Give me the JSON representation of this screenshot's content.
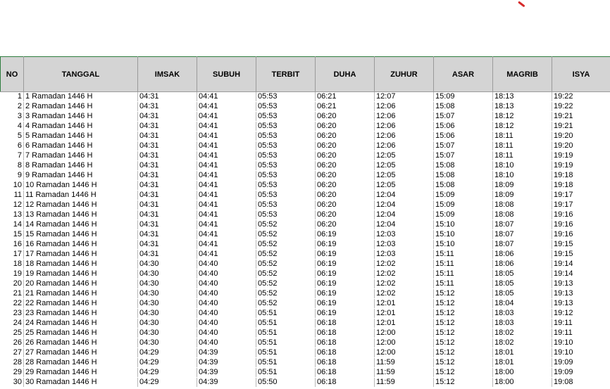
{
  "sheet": {
    "headers": [
      "NO",
      "TANGGAL",
      "IMSAK",
      "SUBUH",
      "TERBIT",
      "DUHA",
      "ZUHUR",
      "ASAR",
      "MAGRIB",
      "ISYA"
    ],
    "rows": [
      [
        "1",
        "1 Ramadan 1446 H",
        "04:31",
        "04:41",
        "05:53",
        "06:21",
        "12:07",
        "15:09",
        "18:13",
        "19:22"
      ],
      [
        "2",
        "2 Ramadan 1446 H",
        "04:31",
        "04:41",
        "05:53",
        "06:21",
        "12:06",
        "15:08",
        "18:13",
        "19:22"
      ],
      [
        "3",
        "3 Ramadan 1446 H",
        "04:31",
        "04:41",
        "05:53",
        "06:20",
        "12:06",
        "15:07",
        "18:12",
        "19:21"
      ],
      [
        "4",
        "4 Ramadan 1446 H",
        "04:31",
        "04:41",
        "05:53",
        "06:20",
        "12:06",
        "15:06",
        "18:12",
        "19:21"
      ],
      [
        "5",
        "5 Ramadan 1446 H",
        "04:31",
        "04:41",
        "05:53",
        "06:20",
        "12:06",
        "15:06",
        "18:11",
        "19:20"
      ],
      [
        "6",
        "6 Ramadan 1446 H",
        "04:31",
        "04:41",
        "05:53",
        "06:20",
        "12:06",
        "15:07",
        "18:11",
        "19:20"
      ],
      [
        "7",
        "7 Ramadan 1446 H",
        "04:31",
        "04:41",
        "05:53",
        "06:20",
        "12:05",
        "15:07",
        "18:11",
        "19:19"
      ],
      [
        "8",
        "8 Ramadan 1446 H",
        "04:31",
        "04:41",
        "05:53",
        "06:20",
        "12:05",
        "15:08",
        "18:10",
        "19:19"
      ],
      [
        "9",
        "9 Ramadan 1446 H",
        "04:31",
        "04:41",
        "05:53",
        "06:20",
        "12:05",
        "15:08",
        "18:10",
        "19:18"
      ],
      [
        "10",
        "10 Ramadan 1446 H",
        "04:31",
        "04:41",
        "05:53",
        "06:20",
        "12:05",
        "15:08",
        "18:09",
        "19:18"
      ],
      [
        "11",
        "11 Ramadan 1446 H",
        "04:31",
        "04:41",
        "05:53",
        "06:20",
        "12:04",
        "15:09",
        "18:09",
        "19:17"
      ],
      [
        "12",
        "12 Ramadan 1446 H",
        "04:31",
        "04:41",
        "05:53",
        "06:20",
        "12:04",
        "15:09",
        "18:08",
        "19:17"
      ],
      [
        "13",
        "13 Ramadan 1446 H",
        "04:31",
        "04:41",
        "05:53",
        "06:20",
        "12:04",
        "15:09",
        "18:08",
        "19:16"
      ],
      [
        "14",
        "14 Ramadan 1446 H",
        "04:31",
        "04:41",
        "05:52",
        "06:20",
        "12:04",
        "15:10",
        "18:07",
        "19:16"
      ],
      [
        "15",
        "15 Ramadan 1446 H",
        "04:31",
        "04:41",
        "05:52",
        "06:19",
        "12:03",
        "15:10",
        "18:07",
        "19:16"
      ],
      [
        "16",
        "16 Ramadan 1446 H",
        "04:31",
        "04:41",
        "05:52",
        "06:19",
        "12:03",
        "15:10",
        "18:07",
        "19:15"
      ],
      [
        "17",
        "17 Ramadan 1446 H",
        "04:31",
        "04:41",
        "05:52",
        "06:19",
        "12:03",
        "15:11",
        "18:06",
        "19:15"
      ],
      [
        "18",
        "18 Ramadan 1446 H",
        "04:30",
        "04:40",
        "05:52",
        "06:19",
        "12:02",
        "15:11",
        "18:06",
        "19:14"
      ],
      [
        "19",
        "19 Ramadan 1446 H",
        "04:30",
        "04:40",
        "05:52",
        "06:19",
        "12:02",
        "15:11",
        "18:05",
        "19:14"
      ],
      [
        "20",
        "20 Ramadan 1446 H",
        "04:30",
        "04:40",
        "05:52",
        "06:19",
        "12:02",
        "15:11",
        "18:05",
        "19:13"
      ],
      [
        "21",
        "21 Ramadan 1446 H",
        "04:30",
        "04:40",
        "05:52",
        "06:19",
        "12:02",
        "15:12",
        "18:05",
        "19:13"
      ],
      [
        "22",
        "22 Ramadan 1446 H",
        "04:30",
        "04:40",
        "05:52",
        "06:19",
        "12:01",
        "15:12",
        "18:04",
        "19:13"
      ],
      [
        "23",
        "23 Ramadan 1446 H",
        "04:30",
        "04:40",
        "05:51",
        "06:19",
        "12:01",
        "15:12",
        "18:03",
        "19:12"
      ],
      [
        "24",
        "24 Ramadan 1446 H",
        "04:30",
        "04:40",
        "05:51",
        "06:18",
        "12:01",
        "15:12",
        "18:03",
        "19:11"
      ],
      [
        "25",
        "25 Ramadan 1446 H",
        "04:30",
        "04:40",
        "05:51",
        "06:18",
        "12:00",
        "15:12",
        "18:02",
        "19:11"
      ],
      [
        "26",
        "26 Ramadan 1446 H",
        "04:30",
        "04:40",
        "05:51",
        "06:18",
        "12:00",
        "15:12",
        "18:02",
        "19:10"
      ],
      [
        "27",
        "27 Ramadan 1446 H",
        "04:29",
        "04:39",
        "05:51",
        "06:18",
        "12:00",
        "15:12",
        "18:01",
        "19:10"
      ],
      [
        "28",
        "28 Ramadan 1446 H",
        "04:29",
        "04:39",
        "05:51",
        "06:18",
        "11:59",
        "15:12",
        "18:01",
        "19:09"
      ],
      [
        "29",
        "29 Ramadan 1446 H",
        "04:29",
        "04:39",
        "05:51",
        "06:18",
        "11:59",
        "15:12",
        "18:00",
        "19:09"
      ],
      [
        "30",
        "30 Ramadan 1446 H",
        "04:29",
        "04:39",
        "05:50",
        "06:18",
        "11:59",
        "15:12",
        "18:00",
        "19:08"
      ]
    ]
  },
  "colors": {
    "header_bg": "#d4d4d4",
    "selection_border": "#2f7d3f",
    "stray_mark": "#d62a2a"
  }
}
